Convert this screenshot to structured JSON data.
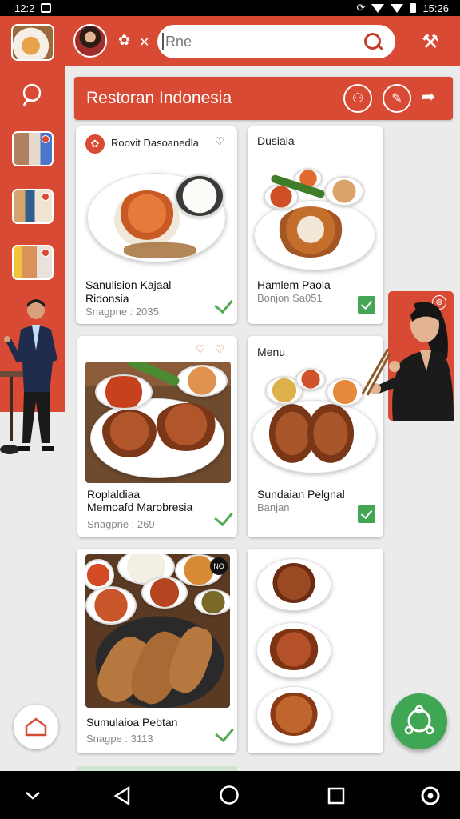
{
  "status_bar": {
    "time_left": "12:2",
    "time_right": "15:26"
  },
  "header": {
    "search": {
      "value": "Rne",
      "placeholder": ""
    }
  },
  "banner": {
    "title": "Restoran Indonesia"
  },
  "cards": [
    {
      "header": "Roovit Dasoanedla",
      "name_line1": "Sanulision Kajaal",
      "name_line2": "Ridonsia",
      "sub": "Snagpne : 2035",
      "checked": false
    },
    {
      "header": "Dusiaia",
      "name_line1": "Hamlem Paola",
      "name_line2": "",
      "sub": "Bonjon Sa051",
      "checked": true
    },
    {
      "header": "",
      "name_line1": "Roplaldiaa",
      "name_line2": "Memoafd Marobresia",
      "sub": "Snagpne : 269",
      "checked": false
    },
    {
      "header": "Menu",
      "name_line1": "Sundaian Pelgnal",
      "name_line2": "",
      "sub": "Banjan",
      "checked": true
    },
    {
      "header": "",
      "name_line1": "Sumulaioa Pebtan",
      "name_line2": "",
      "sub": "Snagpe : 3113",
      "checked": false
    },
    {
      "header": "",
      "name_line1": "",
      "name_line2": "",
      "sub": "",
      "checked": false
    }
  ],
  "photo_badge": "NO",
  "colors": {
    "primary": "#d94a35",
    "accent_green": "#44a655",
    "background": "#ebebeb"
  },
  "icons": [
    "search-icon",
    "settings-icon",
    "chat-icon",
    "tools-icon",
    "user-icon",
    "edit-icon",
    "share-icon",
    "home-icon",
    "assistant-icon",
    "back-icon",
    "circle-home-icon",
    "recents-icon"
  ]
}
